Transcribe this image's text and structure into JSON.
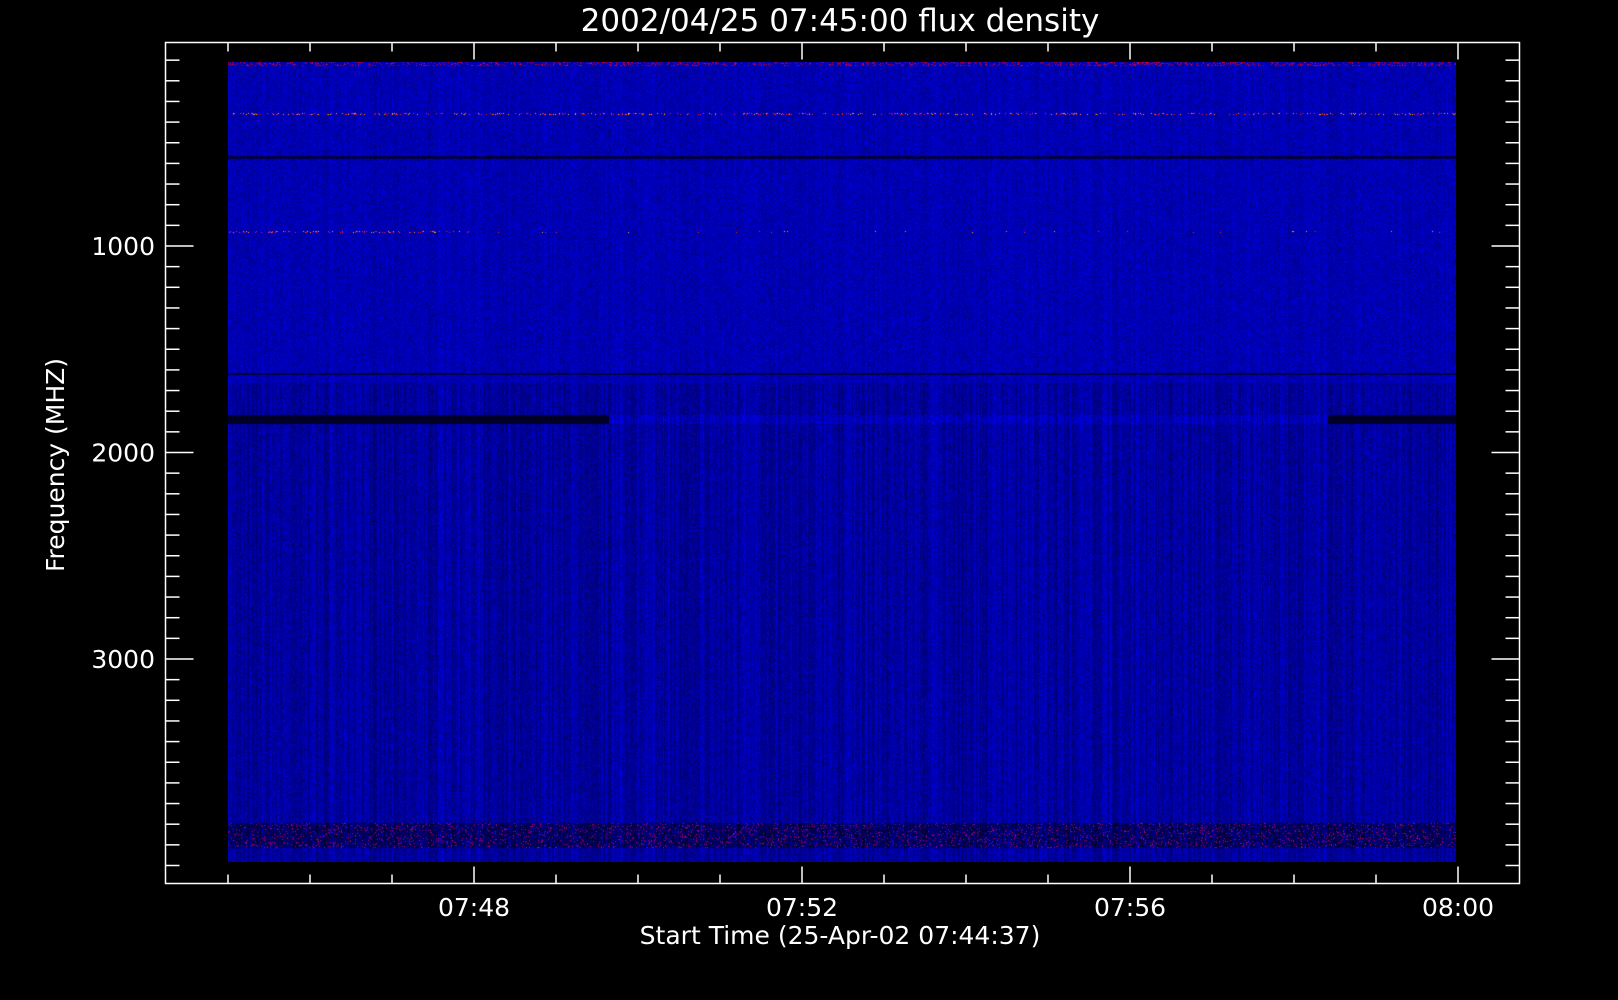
{
  "chart_data": {
    "type": "heatmap",
    "title": "2002/04/25 07:45:00 flux density",
    "xlabel": "Start Time (25-Apr-02 07:44:37)",
    "ylabel": "Frequency (MHZ)",
    "x_unit": "minutes after 07:44:37",
    "xlim_minutes_from_0745": [
      -0.73,
      15.57
    ],
    "x_major_ticks": [
      {
        "min": 3,
        "label": "07:48"
      },
      {
        "min": 7,
        "label": "07:52"
      },
      {
        "min": 11,
        "label": "07:56"
      },
      {
        "min": 15,
        "label": "08:00"
      }
    ],
    "x_minor_tick_step_min": 1,
    "ylim": [
      4080,
      10
    ],
    "y_major_ticks": [
      {
        "value": 1000,
        "label": "1000"
      },
      {
        "value": 2000,
        "label": "2000"
      },
      {
        "value": 3000,
        "label": "3000"
      }
    ],
    "y_minor_tick_step": 100,
    "image_time_range_min": [
      0,
      15
    ],
    "image_freq_range": [
      100,
      3980
    ],
    "colormap": {
      "low": "#000060",
      "mid": "#0000ff",
      "high": "#ff2000",
      "peak": "#ffb000"
    },
    "grid": false,
    "features": [
      {
        "freq": 350,
        "kind": "intermittent-bursts"
      },
      {
        "freq": 920,
        "kind": "intermittent-bursts"
      },
      {
        "freq": 560,
        "kind": "dark-band"
      },
      {
        "freq": 1610,
        "kind": "dark-band"
      },
      {
        "freq": 1830,
        "kind": "dark-band"
      },
      {
        "freq": 3850,
        "kind": "noisy-band"
      }
    ]
  }
}
